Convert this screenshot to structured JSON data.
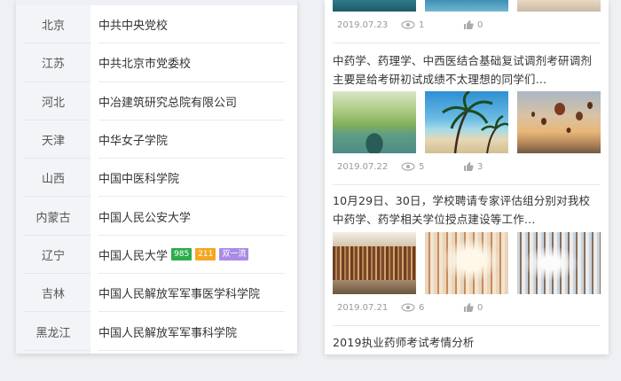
{
  "schools": [
    {
      "province": "北京",
      "school": "中共中央党校",
      "tags": []
    },
    {
      "province": "江苏",
      "school": "中共北京市党委校",
      "tags": []
    },
    {
      "province": "河北",
      "school": "中冶建筑研究总院有限公司",
      "tags": []
    },
    {
      "province": "天津",
      "school": "中华女子学院",
      "tags": []
    },
    {
      "province": "山西",
      "school": "中国中医科学院",
      "tags": []
    },
    {
      "province": "内蒙古",
      "school": "中国人民公安大学",
      "tags": []
    },
    {
      "province": "辽宁",
      "school": "中国人民大学",
      "tags": [
        {
          "text": "985",
          "color": "#2dad4b"
        },
        {
          "text": "211",
          "color": "#f5a623"
        },
        {
          "text": "双一流",
          "color": "#a98ce6"
        }
      ]
    },
    {
      "province": "吉林",
      "school": "中国人民解放军军事医学科学院",
      "tags": []
    },
    {
      "province": "黑龙江",
      "school": "中国人民解放军军事科学院",
      "tags": []
    }
  ],
  "articles": {
    "top_meta": {
      "date": "2019.07.23",
      "views": "1",
      "likes": "0"
    },
    "items": [
      {
        "title": "中药学、药理学、中西医结合基础复试调剂考研调剂主要是给考研初试成绩不太理想的同学们…",
        "images": [
          "willow-lake",
          "palm-beach",
          "hot-air-balloons"
        ],
        "date": "2019.07.22",
        "views": "5",
        "likes": "3"
      },
      {
        "title": "10月29日、30日，学校聘请专家评估组分别对我校中药学、药学相关学位授点建设等工作…",
        "images": [
          "library-curved",
          "library-aisle-bright",
          "library-aisle"
        ],
        "date": "2019.07.21",
        "views": "6",
        "likes": "0"
      }
    ],
    "last_title": "2019执业药师考试考情分析"
  }
}
